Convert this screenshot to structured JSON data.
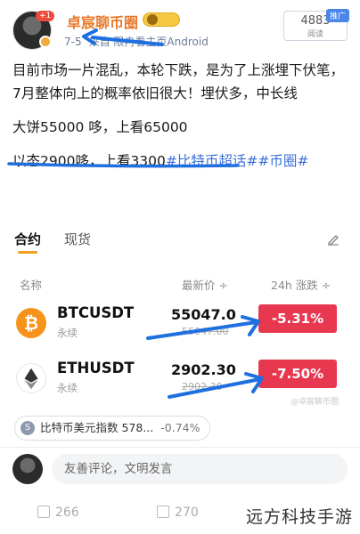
{
  "header": {
    "plus_badge": "+1",
    "username": "卓宸聊币圈",
    "meta_date": "7-5",
    "meta_source": "来自 限冉看主页Android",
    "read_count": "4883",
    "read_label": "阅读",
    "promo_tag": "推广"
  },
  "post": {
    "line1": "目前市场一片混乱，本轮下跌，是为了上涨埋下伏笔，",
    "line2": "7月整体向上的概率依旧很大！埋伏多，中长线",
    "line3": "大饼55000 哆，上看65000",
    "line4_text": "以态2900哆，上看3300",
    "line4_tags": "#比特币超话##币圈#"
  },
  "tabs": {
    "active": "合约",
    "inactive": "现货"
  },
  "table": {
    "col_name": "名称",
    "col_price": "最新价 ÷",
    "col_change": "24h 涨跌 ÷",
    "rows": [
      {
        "icon": "₿",
        "symbol": "BTCUSDT",
        "type": "永续",
        "price": "55047.0",
        "price_sub": "55047.00",
        "change": "-5.31%"
      },
      {
        "icon": "",
        "symbol": "ETHUSDT",
        "type": "永续",
        "price": "2902.30",
        "price_sub": "2902.30",
        "change": "-7.50%"
      }
    ]
  },
  "chip": {
    "icon": "S",
    "label": "比特币美元指数 578...",
    "pct": "-0.74%"
  },
  "comment": {
    "placeholder": "友善评论，文明发言"
  },
  "actions": {
    "share_count": "266",
    "comment_count": "270"
  },
  "watermark": "远方科技手游",
  "watermark_small": "@卓宸聊币圈",
  "colors": {
    "accent_orange": "#e8792a",
    "down_red": "#e8384f",
    "link_blue": "#3a6fd8",
    "annotation_blue": "#1e6fe0"
  }
}
